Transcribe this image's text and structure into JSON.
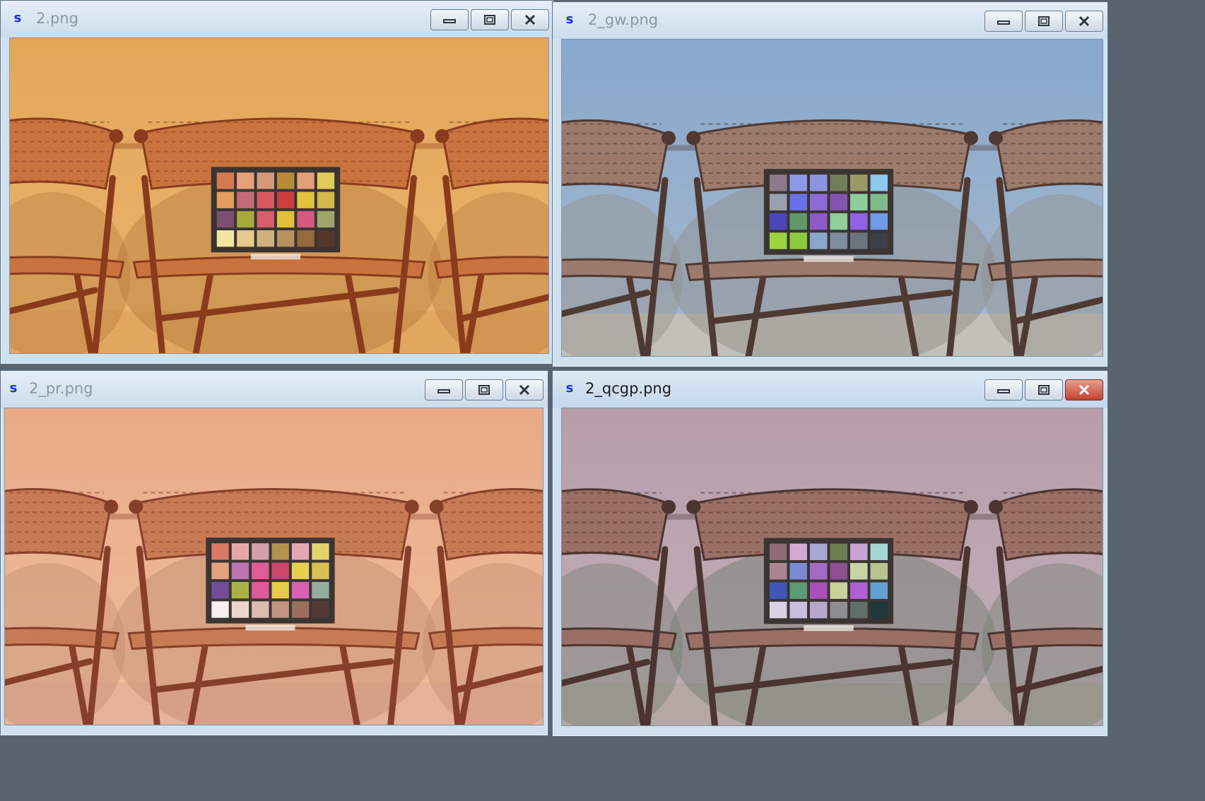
{
  "windows": [
    {
      "id": "w1",
      "title": "2.png",
      "icon": "app-s-icon",
      "icon_glyph": "s",
      "active": false,
      "palette": {
        "wall_top": "#e4a75a",
        "wall_bottom": "#e9b46d",
        "floor": "#e1a75e",
        "chair": "#c9743f",
        "chair_dark": "#8a3b1c",
        "shadow": "#b97a3e"
      },
      "checker": [
        "#d57a4f",
        "#e6a17a",
        "#d49b78",
        "#b88a3a",
        "#e39e7b",
        "#e2c95b",
        "#e29c5b",
        "#c46b7a",
        "#da5864",
        "#cf3e3c",
        "#e2c43c",
        "#d5b64b",
        "#7b4f6f",
        "#a9a838",
        "#d85f6a",
        "#e2c138",
        "#d65a80",
        "#9ea46b",
        "#f2e6a4",
        "#e5c98d",
        "#d3b17f",
        "#b89060",
        "#956a3d",
        "#54362a"
      ]
    },
    {
      "id": "w2",
      "title": "2_gw.png",
      "icon": "app-s-icon",
      "icon_glyph": "s",
      "active": false,
      "palette": {
        "wall_top": "#87a7cc",
        "wall_bottom": "#a8b9cc",
        "floor": "#c4c0b9",
        "chair": "#9c7a6c",
        "chair_dark": "#4f3a33",
        "shadow": "#8f8c88"
      },
      "checker": [
        "#8e7a8a",
        "#8d98e6",
        "#8c96df",
        "#6f7e58",
        "#9a9a67",
        "#8ec8ec",
        "#9aa0ad",
        "#6a6fea",
        "#8e6ad9",
        "#8256b0",
        "#8ccf9a",
        "#7fba8a",
        "#4c46b9",
        "#5f9a6b",
        "#8e5ac7",
        "#8fcf9a",
        "#9060e6",
        "#6f9ae6",
        "#9ad43f",
        "#8ccc3c",
        "#8aa6cc",
        "#7e8ca0",
        "#6b7481",
        "#3c3f45"
      ]
    },
    {
      "id": "w3",
      "title": "2_pr.png",
      "icon": "app-s-icon",
      "icon_glyph": "s",
      "active": false,
      "palette": {
        "wall_top": "#e9aa86",
        "wall_bottom": "#efbe9f",
        "floor": "#e7b398",
        "chair": "#c77b55",
        "chair_dark": "#86402a",
        "shadow": "#c08a6e"
      },
      "checker": [
        "#d87a64",
        "#e7a9a8",
        "#d2a0ad",
        "#b2934e",
        "#e6a7b5",
        "#e2d36e",
        "#e4a27d",
        "#bd74b3",
        "#de5d96",
        "#cf4568",
        "#e8d04e",
        "#d8c055",
        "#734d97",
        "#a9b147",
        "#dd5b99",
        "#e5cc47",
        "#d85fb4",
        "#95ac9c",
        "#f6efee",
        "#ecd5cc",
        "#dbbab0",
        "#c09480",
        "#9c6e5d",
        "#533a37"
      ]
    },
    {
      "id": "w4",
      "title": "2_qcgp.png",
      "icon": "app-s-icon",
      "icon_glyph": "s",
      "active": true,
      "palette": {
        "wall_top": "#b79eaa",
        "wall_bottom": "#c2afb8",
        "floor": "#b5a8a4",
        "chair": "#9a6f65",
        "chair_dark": "#4c3431",
        "shadow": "#6d7a6c"
      },
      "checker": [
        "#8f6c74",
        "#d4a8d4",
        "#a7a7cf",
        "#6c7f53",
        "#c7a4d4",
        "#a7d7d4",
        "#a98592",
        "#7b8ad6",
        "#a46bc6",
        "#8b4f92",
        "#c9d3a3",
        "#b8c293",
        "#3f57b8",
        "#5d9c73",
        "#a951b9",
        "#c8d39a",
        "#b060d3",
        "#63a1cf",
        "#d7d2e4",
        "#c9bfdd",
        "#b7a8c9",
        "#8e8d90",
        "#5f6f66",
        "#1f3737"
      ]
    }
  ],
  "window_buttons": {
    "minimize": "minimize-icon",
    "maximize": "maximize-icon",
    "close": "close-icon"
  }
}
